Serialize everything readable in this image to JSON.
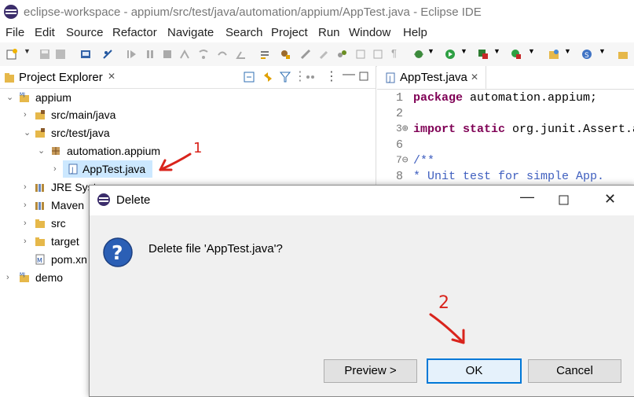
{
  "window": {
    "title": "eclipse-workspace - appium/src/test/java/automation/appium/AppTest.java - Eclipse IDE"
  },
  "menu": [
    "File",
    "Edit",
    "Source",
    "Refactor",
    "Navigate",
    "Search",
    "Project",
    "Run",
    "Window",
    "Help"
  ],
  "explorer": {
    "title": "Project Explorer",
    "tree": [
      {
        "label": "appium"
      },
      {
        "label": "src/main/java"
      },
      {
        "label": "src/test/java"
      },
      {
        "label": "automation.appium"
      },
      {
        "label": "AppTest.java"
      },
      {
        "label": "JRE Syst"
      },
      {
        "label": "Maven"
      },
      {
        "label": "src"
      },
      {
        "label": "target"
      },
      {
        "label": "pom.xn"
      },
      {
        "label": "demo"
      }
    ]
  },
  "editor": {
    "tab": "AppTest.java",
    "lines": [
      {
        "n": "1",
        "kw": "package",
        "rest": " automation.appium;"
      },
      {
        "n": "2",
        "kw": "",
        "rest": ""
      },
      {
        "n": "3⊕",
        "kw": "import static",
        "rest": " org.junit.Assert.a"
      },
      {
        "n": "6",
        "kw": "",
        "rest": ""
      },
      {
        "n": "7⊖",
        "kw": "",
        "rest": "/**"
      },
      {
        "n": "8",
        "kw": "",
        "rest": " * Unit test for simple App."
      }
    ]
  },
  "dialog": {
    "title": "Delete",
    "message": "Delete file 'AppTest.java'?",
    "buttons": {
      "preview": "Preview >",
      "ok": "OK",
      "cancel": "Cancel"
    }
  },
  "annotations": {
    "one": "1",
    "two": "2"
  },
  "colors": {
    "accent_red": "#d9241c",
    "keyword": "#7f0055",
    "comment": "#3f5fbf",
    "selection": "#cce8ff"
  }
}
